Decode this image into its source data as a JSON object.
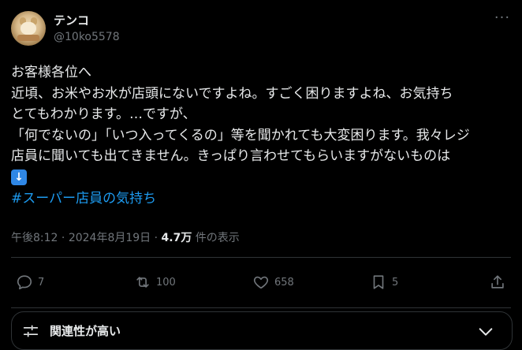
{
  "user": {
    "display_name": "テンコ",
    "handle": "@10ko5578"
  },
  "post": {
    "lines": [
      "お客様各位へ",
      "近頃、お米やお水が店頭にないですよね。すごく困りますよね、お気持ち",
      "とてもわかります。…ですが、",
      "「何でないの」「いつ入ってくるの」等を聞かれても大変困ります。我々レジ",
      "店員に聞いても出てきません。きっぱり言わせてもらいますがないものは"
    ],
    "emoji": "down-arrow-emoji",
    "hashtag": "#スーパー店員の気持ち"
  },
  "meta": {
    "time": "午後8:12",
    "sep1": " · ",
    "date": "2024年8月19日",
    "sep2": " · ",
    "views_count": "4.7万",
    "views_label": " 件の表示"
  },
  "actions": {
    "replies": "7",
    "reposts": "100",
    "likes": "658",
    "bookmarks": "5"
  },
  "relevance": {
    "label": "関連性が高い"
  },
  "colors": {
    "background": "#000000",
    "text": "#e7e9ea",
    "muted": "#71767b",
    "accent": "#1d9bf0",
    "border": "#2f3336"
  }
}
